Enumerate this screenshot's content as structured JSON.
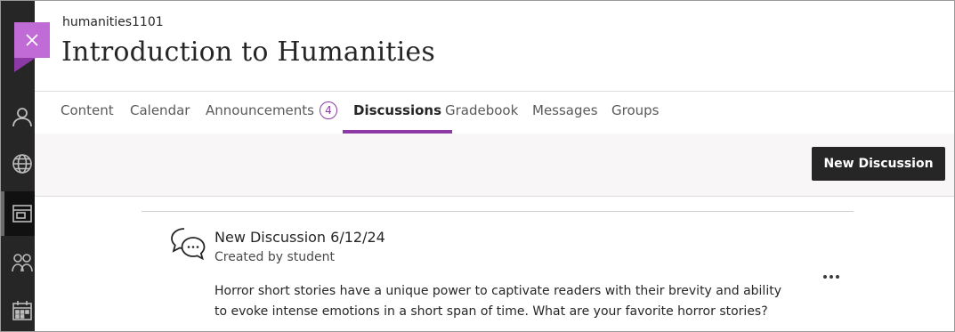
{
  "course": {
    "code": "humanities1101",
    "title": "Introduction to Humanities"
  },
  "nav": {
    "tabs": [
      {
        "label": "Content"
      },
      {
        "label": "Calendar"
      },
      {
        "label": "Announcements",
        "badge": "4"
      },
      {
        "label": "Discussions",
        "active": true
      },
      {
        "label": "Gradebook"
      },
      {
        "label": "Messages"
      },
      {
        "label": "Groups"
      }
    ]
  },
  "toolbar": {
    "new_discussion_label": "New Discussion"
  },
  "discussion": {
    "title": "New Discussion 6/12/24",
    "meta": "Created by student",
    "body": "Horror short stories have a unique power to captivate readers with their brevity and ability to evoke intense emotions in a short span of time. What are your favorite horror stories?",
    "icon": "discussion-bubbles-icon",
    "more_icon": "more-options-icon"
  },
  "rail": {
    "icons": [
      "profile-icon",
      "globe-icon",
      "courses-icon",
      "groups-icon",
      "calendar-icon"
    ]
  },
  "colors": {
    "accent": "#8d3aa6",
    "close_button": "#c06bd6",
    "rail_bg": "#262626",
    "primary_button": "#262626"
  }
}
